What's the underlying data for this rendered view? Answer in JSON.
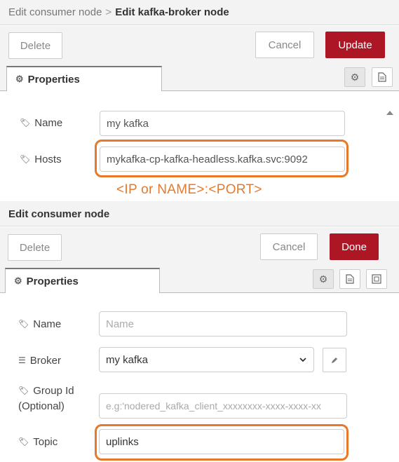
{
  "top": {
    "breadcrumb": {
      "parent": "Edit consumer node",
      "separator": ">",
      "current": "Edit kafka-broker node"
    },
    "buttons": {
      "delete": "Delete",
      "cancel": "Cancel",
      "update": "Update"
    },
    "tab": {
      "label": "Properties",
      "icon": "gear-icon"
    },
    "fields": {
      "name": {
        "label": "Name",
        "value": "my kafka",
        "icon": "tag-icon"
      },
      "hosts": {
        "label": "Hosts",
        "value": "mykafka-cp-kafka-headless.kafka.svc:9092",
        "icon": "tag-icon"
      }
    }
  },
  "annotation": "<IP or NAME>:<PORT>",
  "bottom": {
    "title": "Edit consumer node",
    "buttons": {
      "delete": "Delete",
      "cancel": "Cancel",
      "done": "Done"
    },
    "tab": {
      "label": "Properties",
      "icon": "gear-icon"
    },
    "fields": {
      "name": {
        "label": "Name",
        "placeholder": "Name",
        "icon": "tag-icon"
      },
      "broker": {
        "label": "Broker",
        "value": "my kafka",
        "icon": "list-icon"
      },
      "group_id": {
        "label": "Group Id",
        "label2": "(Optional)",
        "placeholder": "e.g:'nodered_kafka_client_xxxxxxxx-xxxx-xxxx-xx",
        "icon": "tag-icon"
      },
      "topic": {
        "label": "Topic",
        "value": "uplinks",
        "icon": "tag-icon"
      }
    }
  },
  "colors": {
    "primary": "#ad1625",
    "highlight": "#e8792a"
  }
}
